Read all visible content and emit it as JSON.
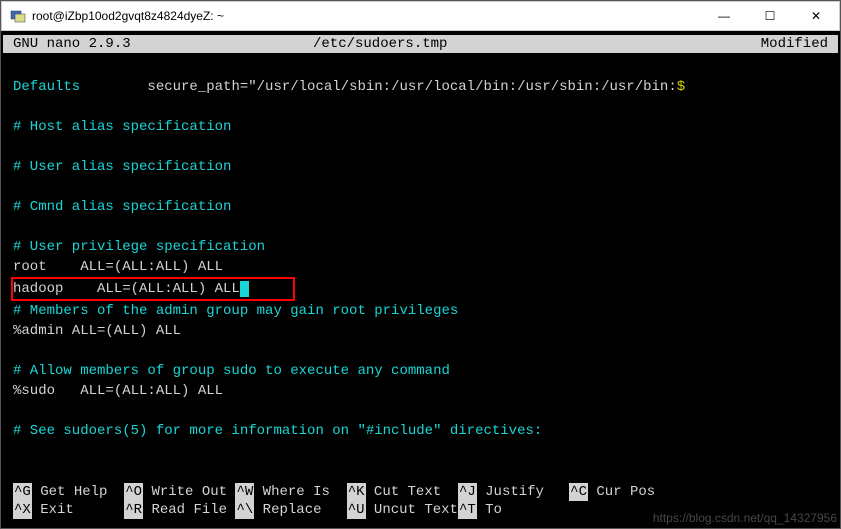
{
  "titlebar": {
    "text": "root@iZbp10od2gvqt8z4824dyeZ: ~"
  },
  "editor_header": {
    "app": "  GNU nano 2.9.3",
    "file": "/etc/sudoers.tmp",
    "status": "Modified "
  },
  "content": {
    "defaults_label": "Defaults",
    "defaults_value": "        secure_path=\"/usr/local/sbin:/usr/local/bin:/usr/sbin:/usr/bin:",
    "defaults_tail": "$",
    "host_alias": "# Host alias specification",
    "user_alias": "# User alias specification",
    "cmnd_alias": "# Cmnd alias specification",
    "user_priv": "# User privilege specification",
    "root": "root    ALL=(ALL:ALL) ALL",
    "hadoop": "hadoop    ALL=(ALL:ALL) ALL",
    "admin_comment": "# Members of the admin group may gain root privileges",
    "admin_line": "%admin ALL=(ALL) ALL",
    "sudo_comment": "# Allow members of group sudo to execute any command",
    "sudo_line": "%sudo   ALL=(ALL:ALL) ALL",
    "see_comment": "# See sudoers(5) for more information on \"#include\" directives:"
  },
  "shortcuts": {
    "row1": [
      {
        "key": "^G",
        "label": " Get Help  "
      },
      {
        "key": "^O",
        "label": " Write Out "
      },
      {
        "key": "^W",
        "label": " Where Is  "
      },
      {
        "key": "^K",
        "label": " Cut Text  "
      },
      {
        "key": "^J",
        "label": " Justify   "
      },
      {
        "key": "^C",
        "label": " Cur Pos   "
      }
    ],
    "row2": [
      {
        "key": "^X",
        "label": " Exit      "
      },
      {
        "key": "^R",
        "label": " Read File "
      },
      {
        "key": "^\\",
        "label": " Replace   "
      },
      {
        "key": "^U",
        "label": " Uncut Text"
      },
      {
        "key": "^T",
        "label": " To "
      },
      {
        "key": "",
        "label": ""
      }
    ]
  },
  "watermark": "https://blog.csdn.net/qq_14327956"
}
